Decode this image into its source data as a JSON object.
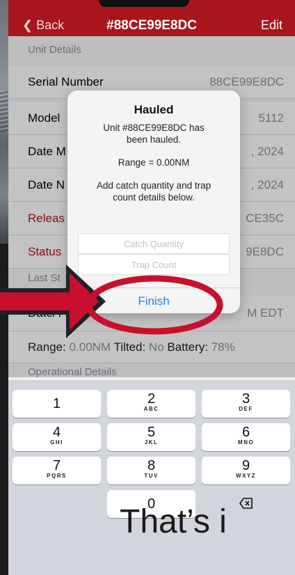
{
  "nav": {
    "back": "Back",
    "title": "#88CE99E8DC",
    "edit": "Edit"
  },
  "sections": {
    "unit_details": "Unit Details",
    "last_status": "Last St",
    "operational": "Operational Details"
  },
  "rows": [
    {
      "label": "Serial Number",
      "value": "88CE99E8DC"
    },
    {
      "label": "Model",
      "value": "5112"
    },
    {
      "label": "Date M",
      "value": ", 2024"
    },
    {
      "label": "Date N",
      "value": ", 2024"
    },
    {
      "label": "Releas",
      "value": "CE35C"
    },
    {
      "label": "Status",
      "value": "9E8DC"
    }
  ],
  "last_status_row": {
    "label": "Date/T",
    "value": "M EDT"
  },
  "range_row": {
    "range_label": "Range:",
    "range_value": "0.00NM",
    "tilted_label": "Tilted:",
    "tilted_value": "No",
    "battery_label": "Battery:",
    "battery_value": "78%"
  },
  "alert": {
    "title": "Hauled",
    "line1": "Unit #88CE99E8DC has",
    "line2": "been hauled.",
    "range": "Range = 0.00NM",
    "line3": "Add catch quantity and trap",
    "line4": "count details below.",
    "catch_placeholder": "Catch Quantity",
    "trap_placeholder": "Trap Count",
    "finish": "Finish"
  },
  "keys": [
    {
      "digit": "1",
      "letters": ""
    },
    {
      "digit": "2",
      "letters": "ABC"
    },
    {
      "digit": "3",
      "letters": "DEF"
    },
    {
      "digit": "4",
      "letters": "GHI"
    },
    {
      "digit": "5",
      "letters": "JKL"
    },
    {
      "digit": "6",
      "letters": "MNO"
    },
    {
      "digit": "7",
      "letters": "PQRS"
    },
    {
      "digit": "8",
      "letters": "TUV"
    },
    {
      "digit": "9",
      "letters": "WXYZ"
    },
    {
      "digit": "0",
      "letters": ""
    }
  ],
  "overlay_caption": "That’s i",
  "colors": {
    "nav": "#a8151c",
    "link": "#2a7de1",
    "annotation": "#c8102e"
  }
}
